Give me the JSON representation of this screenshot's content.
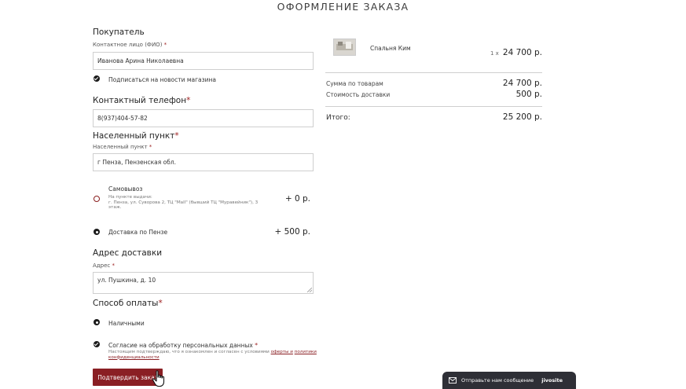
{
  "page": {
    "title": "ОФОРМЛЕНИЕ ЗАКАЗА"
  },
  "buyer": {
    "heading": "Покупатель",
    "name_label": "Контактное лицо (ФИО)",
    "name_value": "Иванова Арина Николаевна",
    "subscribe_label": "Подписаться на новости магазина"
  },
  "phone": {
    "heading": "Контактный телефон",
    "value": "8(937)404-57-82"
  },
  "city": {
    "heading": "Населенный пункт",
    "label": "Населенный пункт",
    "value": "г Пенза, Пензенская обл."
  },
  "delivery": {
    "options": [
      {
        "title": "Самовывоз",
        "note": "На пункте выдачи:\nг. Пенза, ул. Суворова 2, ТЦ \"Mall\" (бывший ТЦ \"Муравейник\"), 3 этаж.",
        "price": "+ 0 р.",
        "selected": false
      },
      {
        "title": "Доставка по Пензе",
        "price": "+ 500 р.",
        "selected": true
      }
    ]
  },
  "address": {
    "heading": "Адрес доставки",
    "label": "Адрес",
    "value": "ул. Пушкина, д. 10"
  },
  "payment": {
    "heading": "Способ оплаты",
    "option_label": "Наличными"
  },
  "consent": {
    "title": "Согласие на обработку персональных данных",
    "text_prefix": "Настоящим подтверждаю, что я ознакомлен и согласен с условиями ",
    "link1": "оферты и",
    "link2": "политики конфиденциальности"
  },
  "submit": {
    "label": "Подтвердить заказ"
  },
  "cart": {
    "item_name": "Спальня Ким",
    "qty": "1 x",
    "item_price": "24 700 р.",
    "subtotal_label": "Сумма по товарам",
    "subtotal_value": "24 700 р.",
    "shipping_label": "Стоимость доставки",
    "shipping_value": "500 р.",
    "total_label": "Итого:",
    "total_value": "25 200 р."
  },
  "chat": {
    "label": "Отправьте нам сообщение",
    "brand": "jivosite"
  },
  "colors": {
    "accent": "#8a1f24",
    "chat_bg": "#2e2f36"
  }
}
